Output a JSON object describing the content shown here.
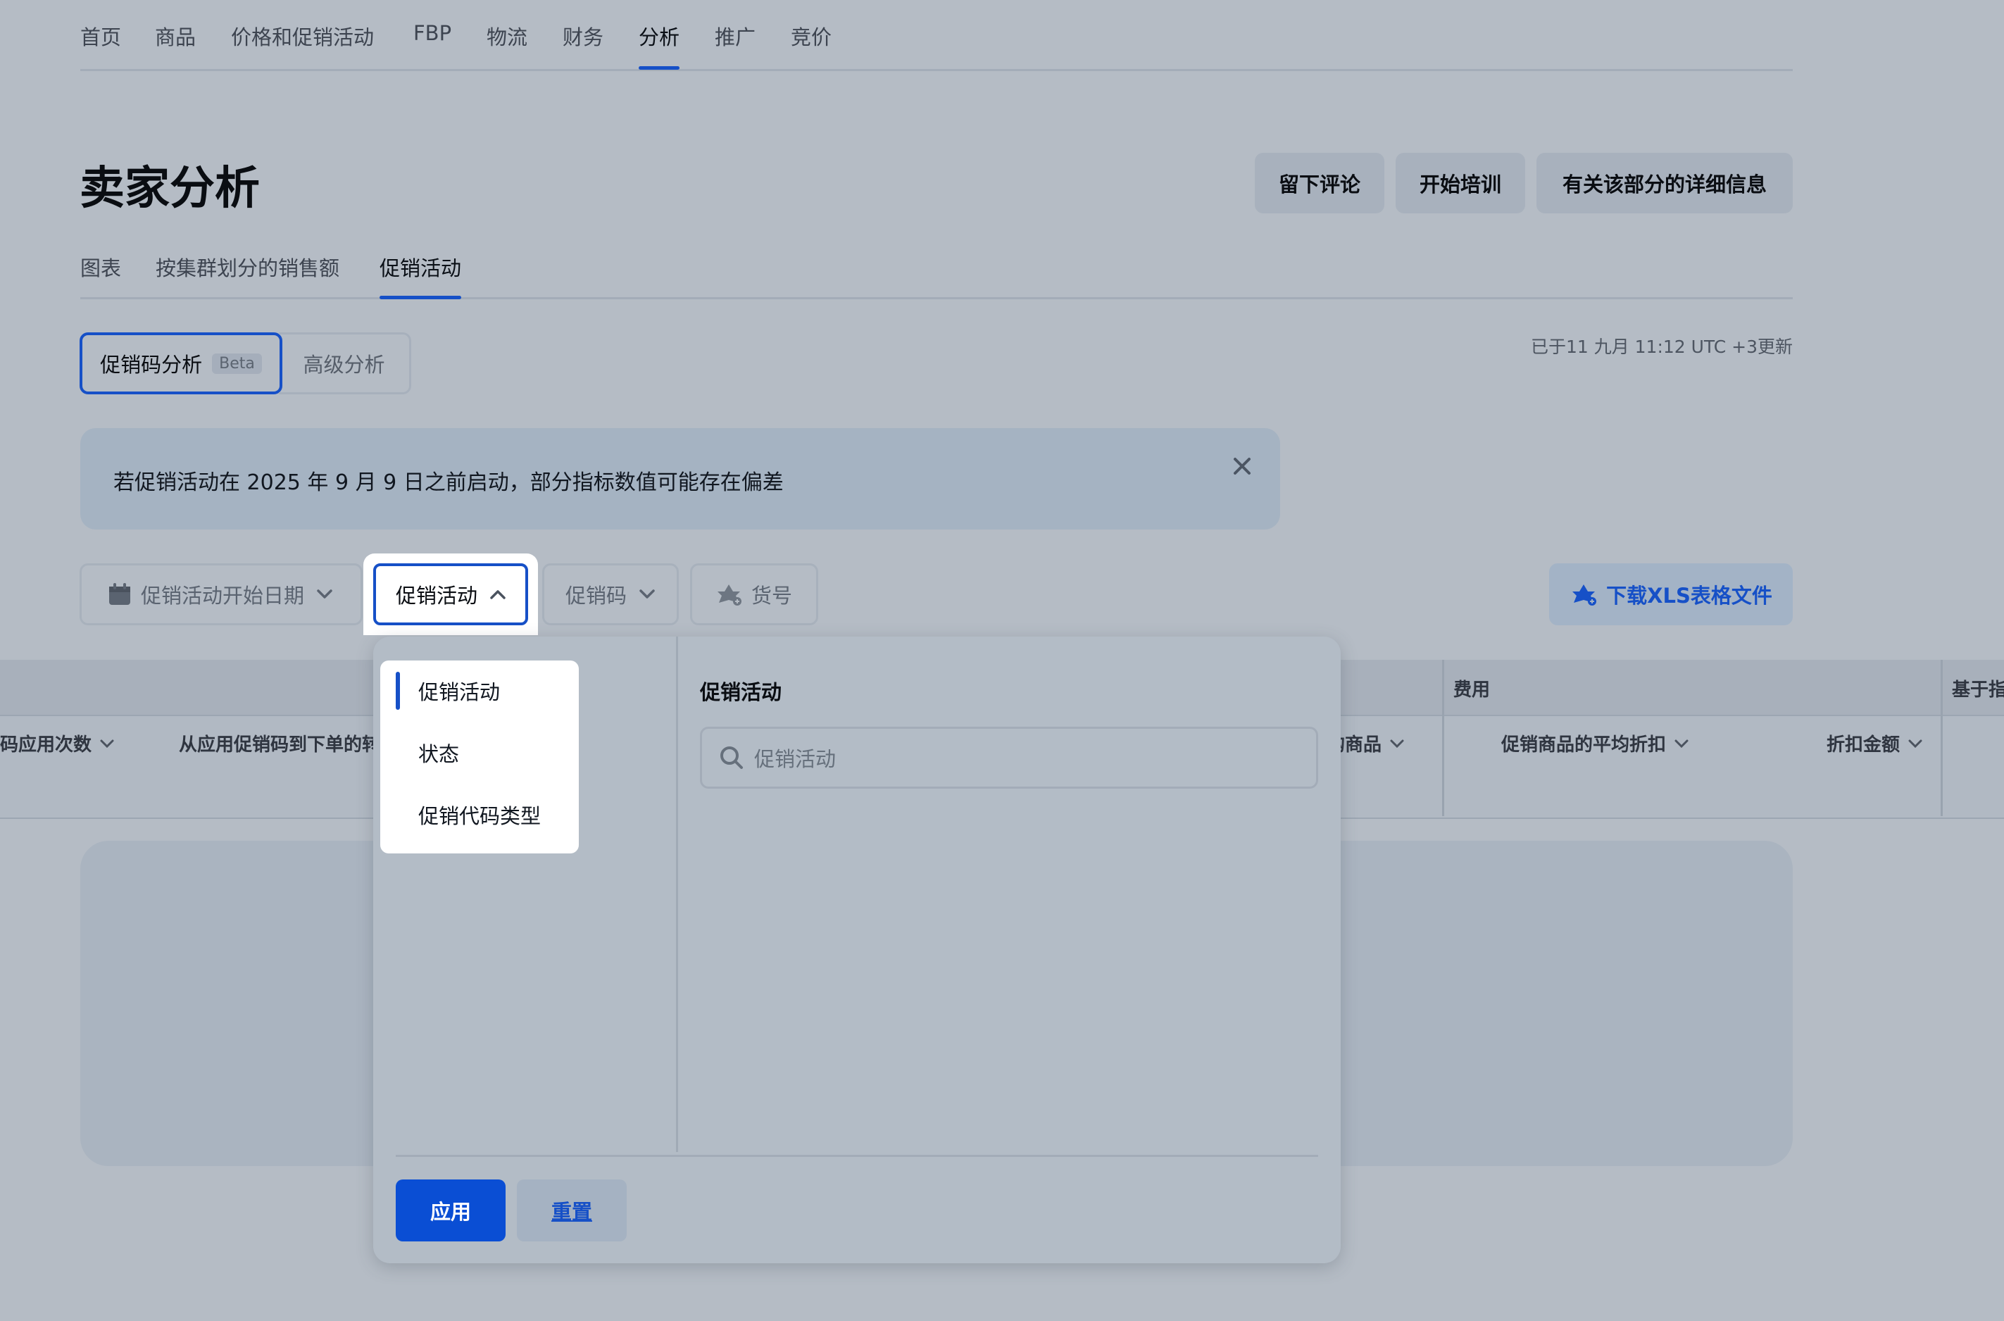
{
  "top_nav": {
    "tabs": [
      "首页",
      "商品",
      "价格和促销活动",
      "FBP",
      "物流",
      "财务",
      "分析",
      "推广",
      "竞价"
    ],
    "active": "分析"
  },
  "header": {
    "title": "卖家分析",
    "buttons": [
      "留下评论",
      "开始培训",
      "有关该部分的详细信息"
    ]
  },
  "sub_tabs": {
    "tabs": [
      "图表",
      "按集群划分的销售额",
      "促销活动"
    ],
    "active": "促销活动"
  },
  "segments": {
    "promo_code_analysis": "促销码分析",
    "beta": "Beta",
    "advanced": "高级分析"
  },
  "updated_text": "已于11 九月 11:12 UTC +3更新",
  "notice": {
    "text": "若促销活动在 2025 年 9 月 9 日之前启动，部分指标数值可能存在偏差",
    "close_icon": "close-icon"
  },
  "filters": {
    "start_date": "促销活动开始日期",
    "promotion": "促销活动",
    "promo_code": "促销码",
    "sku": "货号",
    "download": "下载XLS表格文件"
  },
  "table": {
    "groups": [
      "费用",
      "基于指"
    ],
    "columns": [
      "码应用次数",
      "从应用促销码到下单的转",
      "购商品",
      "促销商品的平均折扣",
      "折扣金额"
    ]
  },
  "dropdown": {
    "menu_items": [
      "促销活动",
      "状态",
      "促销代码类型"
    ],
    "active_item": "促销活动",
    "right_title": "促销活动",
    "search_placeholder": "促销活动",
    "apply": "应用",
    "reset": "重置"
  },
  "colors": {
    "accent": "#1650c7",
    "overlay_background": "#b5bcc5"
  }
}
